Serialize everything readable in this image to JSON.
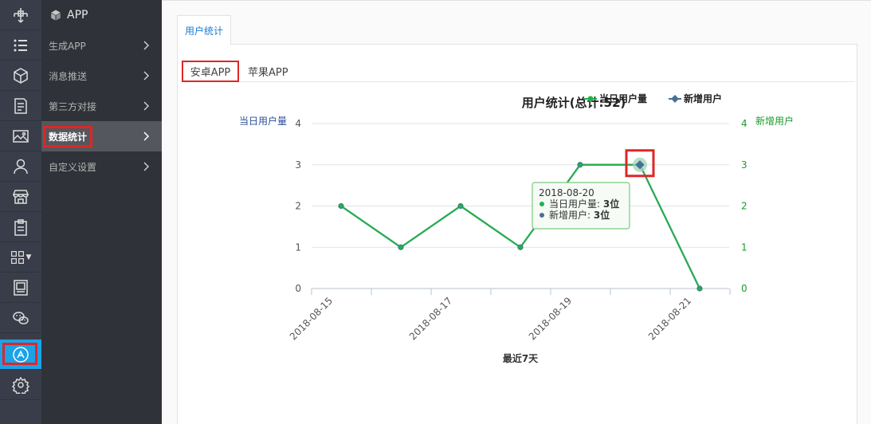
{
  "app": {
    "section_title": "APP"
  },
  "rail": {
    "icons": [
      "compass-icon",
      "list-icon",
      "cube-icon",
      "document-icon",
      "image-icon",
      "user-icon",
      "store-icon",
      "clipboard-icon",
      "grid-icon",
      "book-icon",
      "wechat-icon",
      "app-store-icon",
      "settings-icon"
    ]
  },
  "submenu": {
    "items": [
      {
        "label": "生成APP"
      },
      {
        "label": "消息推送"
      },
      {
        "label": "第三方对接"
      },
      {
        "label": "数据统计"
      },
      {
        "label": "自定义设置"
      }
    ]
  },
  "main": {
    "tab_label": "用户统计",
    "subtabs": [
      {
        "label": "安卓APP"
      },
      {
        "label": "苹果APP"
      }
    ]
  },
  "tooltip": {
    "date": "2018-08-20",
    "rows": [
      {
        "label": "当日用户量: ",
        "value": "3位",
        "color": "#22b14c"
      },
      {
        "label": "新增用户: ",
        "value": "3位",
        "color": "#4a6f96"
      }
    ]
  },
  "chart_data": {
    "type": "line",
    "title": "用户统计(总计:52)",
    "x": [
      "2018-08-15",
      "2018-08-16",
      "2018-08-17",
      "2018-08-18",
      "2018-08-19",
      "2018-08-20",
      "2018-08-21"
    ],
    "x_tick_labels": [
      "2018-08-15",
      "2018-08-17",
      "2018-08-19",
      "2018-08-21"
    ],
    "xlabel": "最近7天",
    "ylabel_left": "当日用户量",
    "ylabel_right": "新增用户",
    "ylim": [
      0,
      4
    ],
    "y_ticks": [
      "0",
      "1",
      "2",
      "3",
      "4"
    ],
    "grid": true,
    "legend_position": "top-right",
    "series": [
      {
        "name": "当日用户量",
        "color": "#22b14c",
        "values": [
          2,
          1,
          2,
          1,
          3,
          3,
          0
        ]
      },
      {
        "name": "新增用户",
        "color": "#4a6f96",
        "values": [
          2,
          1,
          2,
          1,
          3,
          3,
          0
        ]
      }
    ]
  }
}
